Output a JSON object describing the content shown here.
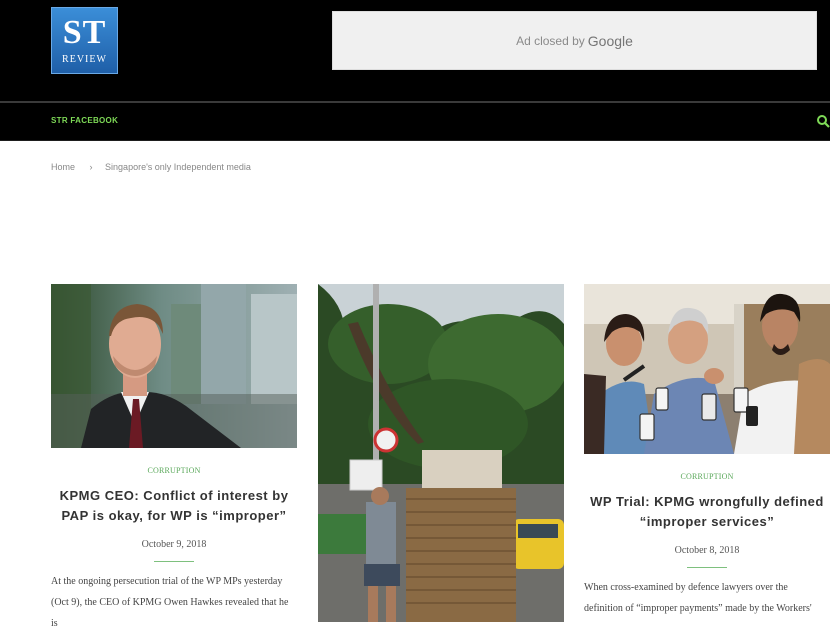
{
  "header": {
    "logo_main": "ST",
    "logo_sub": "REVIEW",
    "ad_text": "Ad closed by",
    "ad_brand": "Google"
  },
  "nav": {
    "facebook_label": "STR FACEBOOK",
    "search_icon": "search-icon"
  },
  "breadcrumb": {
    "home": "Home",
    "separator": "›",
    "current": "Singapore's only Independent media"
  },
  "colors": {
    "accent": "#7ed957",
    "category": "#5aa85a",
    "header_bg": "#000000"
  },
  "articles": [
    {
      "category": "CORRUPTION",
      "title": "KPMG CEO: Conflict of interest by PAP is okay, for WP is “improper”",
      "date": "October 9, 2018",
      "excerpt_line1": "At the ongoing persecution trial of the WP MPs yesterday",
      "excerpt_line2": "(Oct 9), the CEO of KPMG Owen Hawkes revealed that he is"
    },
    {
      "category": "",
      "title": "",
      "date": "",
      "excerpt_line1": "",
      "excerpt_line2": ""
    },
    {
      "category": "CORRUPTION",
      "title": "WP Trial: KPMG wrongfully defined “improper services”",
      "date": "October 8, 2018",
      "excerpt_line1": "When cross-examined by defence lawyers over the",
      "excerpt_line2": "definition of “improper payments” made by the Workers'"
    }
  ]
}
